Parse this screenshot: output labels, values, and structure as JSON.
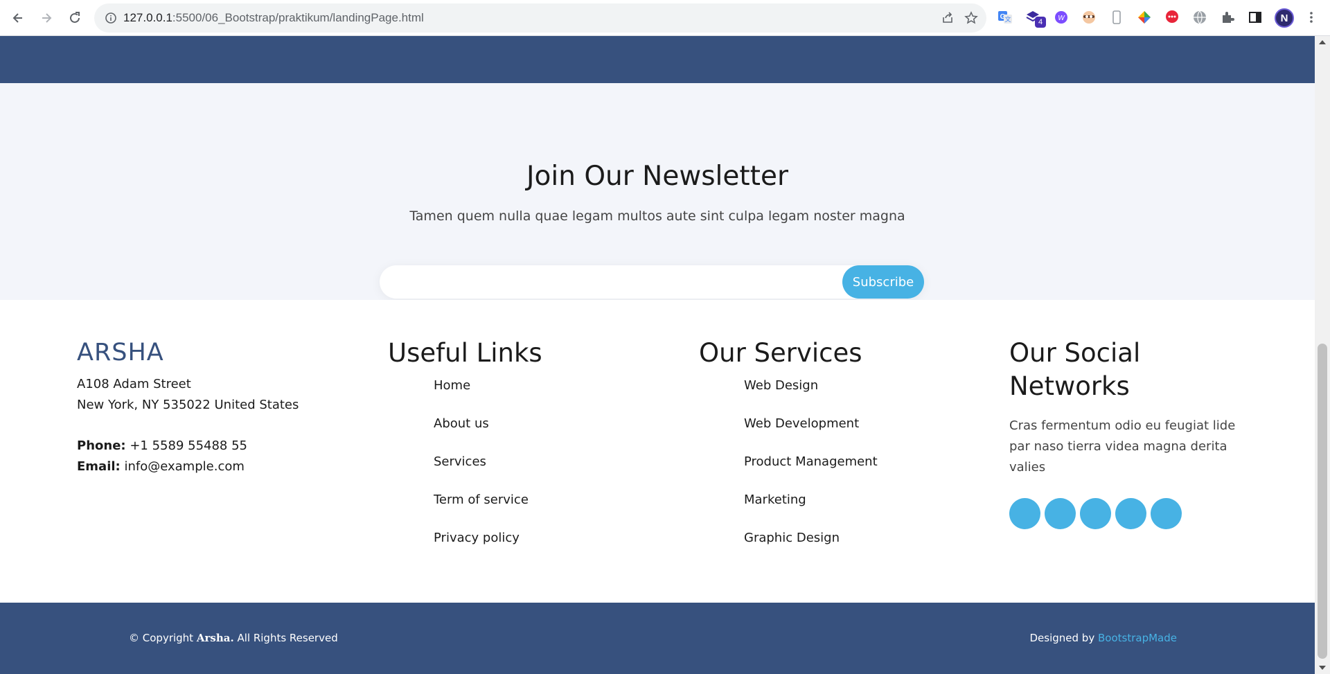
{
  "browser": {
    "url_host": "127.0.0.1",
    "url_path": ":5500/06_Bootstrap/praktikum/landingPage.html",
    "extension_badge": "4",
    "profile_initial": "N",
    "extensions": [
      "google-translate-icon",
      "stacked-extension-icon",
      "circle-w-extension-icon",
      "face-extension-icon",
      "phone-frame-icon",
      "diamond-extension-icon",
      "chat-bubble-icon",
      "globe-icon",
      "puzzle-icon",
      "side-panel-icon"
    ]
  },
  "newsletter": {
    "title": "Join Our Newsletter",
    "subtitle": "Tamen quem nulla quae legam multos aute sint culpa legam noster magna",
    "input_value": "",
    "subscribe_label": "Subscribe"
  },
  "footer": {
    "brand": "ARSHA",
    "address_line1": "A108 Adam Street",
    "address_line2": "New York, NY 535022 United States",
    "phone_label": "Phone:",
    "phone_value": "+1 5589 55488 55",
    "email_label": "Email:",
    "email_value": "info@example.com",
    "useful_links": {
      "title": "Useful Links",
      "items": [
        "Home",
        "About us",
        "Services",
        "Term of service",
        "Privacy policy"
      ]
    },
    "services": {
      "title": "Our Services",
      "items": [
        "Web Design",
        "Web Development",
        "Product Management",
        "Marketing",
        "Graphic Design"
      ]
    },
    "social": {
      "title_line1": "Our Social",
      "title_line2": "Networks",
      "text": "Cras fermentum odio eu feugiat lide par naso tierra videa magna derita valies",
      "buttons": [
        "social-button-1",
        "social-button-2",
        "social-button-3",
        "social-button-4",
        "social-button-5"
      ]
    },
    "copyright_prefix": "© Copyright",
    "copyright_brand": "Arsha.",
    "copyright_suffix": "All Rights Reserved",
    "designed_by_label": "Designed by",
    "designed_by_link": "BootstrapMade"
  },
  "colors": {
    "primary_dark": "#37517e",
    "accent": "#47b2e4",
    "newsletter_bg": "#f3f5fa"
  }
}
